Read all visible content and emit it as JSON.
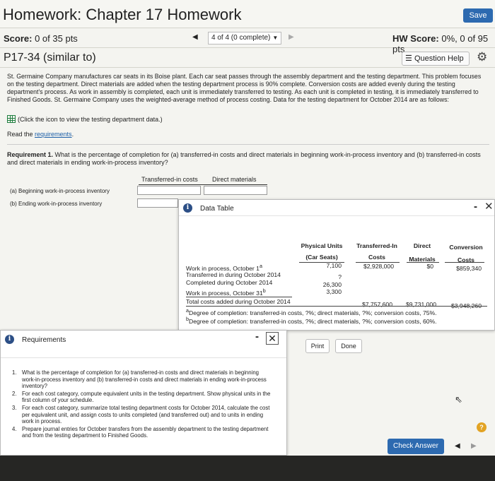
{
  "header": {
    "title": "Homework: Chapter 17 Homework",
    "save_label": "Save"
  },
  "scorebar": {
    "score_label": "Score:",
    "score_value": "0 of 35 pts",
    "question_selector": "4 of 4 (0 complete)",
    "hw_score_label": "HW Score:",
    "hw_score_value": "0%, 0 of 95 pts"
  },
  "question": {
    "title": "P17-34 (similar to)",
    "help_label": "Question Help",
    "problem_text": "St. Germaine Company manufactures car seats in its Boise plant. Each car seat passes through the assembly department and the testing department. This problem focuses on the testing department. Direct materials are added when the testing department process is 90% complete. Conversion costs are added evenly during the testing department's process. As work in assembly is completed, each unit is immediately transferred to testing. As each unit is completed in testing, it is immediately transferred to Finished Goods. St. Germaine Company uses the weighted-average method of process costing. Data for the testing department for October 2014 are as follows:",
    "click_text": "(Click the icon to view the testing department data.)",
    "read_prefix": "Read the ",
    "read_link": "requirements",
    "read_suffix": ".",
    "requirement1_label": "Requirement 1.",
    "requirement1_text": " What is the percentage of completion for (a) transferred-in costs and direct materials in beginning work-in-process inventory and (b) transferred-in costs and direct materials in ending work-in-process inventory?",
    "answer_table": {
      "col1": "Transferred-in costs",
      "col2": "Direct materials",
      "row_a": "(a)   Beginning work-in-process inventory",
      "row_b": "(b)   Ending work-in-process inventory"
    }
  },
  "data_table": {
    "title": "Data Table",
    "headers": {
      "physical_units": [
        "Physical Units",
        "(Car Seats)"
      ],
      "transferred_in": [
        "Transferred-In",
        "Costs"
      ],
      "direct_materials": [
        "Direct",
        "Materials"
      ],
      "conversion": [
        "Conversion",
        "Costs"
      ]
    },
    "rows": [
      {
        "label": "Work in process, October 1",
        "sup": "a",
        "units": "7,100",
        "transferred": "$2,928,000",
        "materials": "$0",
        "conversion": "$859,340"
      },
      {
        "label": "Transferred in during October 2014",
        "sup": "",
        "units": "?",
        "transferred": "",
        "materials": "",
        "conversion": ""
      },
      {
        "label": "Completed during October 2014",
        "sup": "",
        "units": "26,300",
        "transferred": "",
        "materials": "",
        "conversion": ""
      },
      {
        "label": "Work in process, October 31",
        "sup": "b",
        "units": "3,300",
        "transferred": "",
        "materials": "",
        "conversion": ""
      },
      {
        "label": "Total costs added during October 2014",
        "sup": "",
        "units": "",
        "transferred": "$7,757,600",
        "materials": "$9,731,000",
        "conversion": "$3,948,260"
      }
    ],
    "footnote_a": "Degree of completion: transferred-in costs, ?%; direct materials, ?%; conversion costs, 75%.",
    "footnote_b": "Degree of completion: transferred-in costs, ?%; direct materials, ?%; conversion costs, 60%.",
    "print_label": "Print",
    "done_label": "Done"
  },
  "requirements_popup": {
    "title": "Requirements",
    "items": [
      {
        "num": "1.",
        "text": "What is the percentage of completion for (a) transferred-in costs and direct materials in beginning work-in-process inventory and (b) transferred-in costs and direct materials in ending work-in-process inventory?"
      },
      {
        "num": "2.",
        "text": "For each cost category, compute equivalent units in the testing department. Show physical units in the first column of your schedule."
      },
      {
        "num": "3.",
        "text": "For each cost category, summarize total testing department costs for October 2014, calculate the cost per equivalent unit, and assign costs to units completed (and transferred out) and to units in ending work in process."
      },
      {
        "num": "4.",
        "text": "Prepare journal entries for October transfers from the assembly department to the testing department and from the testing department to Finished Goods."
      }
    ]
  },
  "footer": {
    "check_answer_label": "Check Answer",
    "help_symbol": "?"
  },
  "colors": {
    "primary_blue": "#2d6ab0",
    "info_icon": "#2c4f86",
    "help_orange": "#e2a324",
    "link": "#1c5fa8"
  }
}
